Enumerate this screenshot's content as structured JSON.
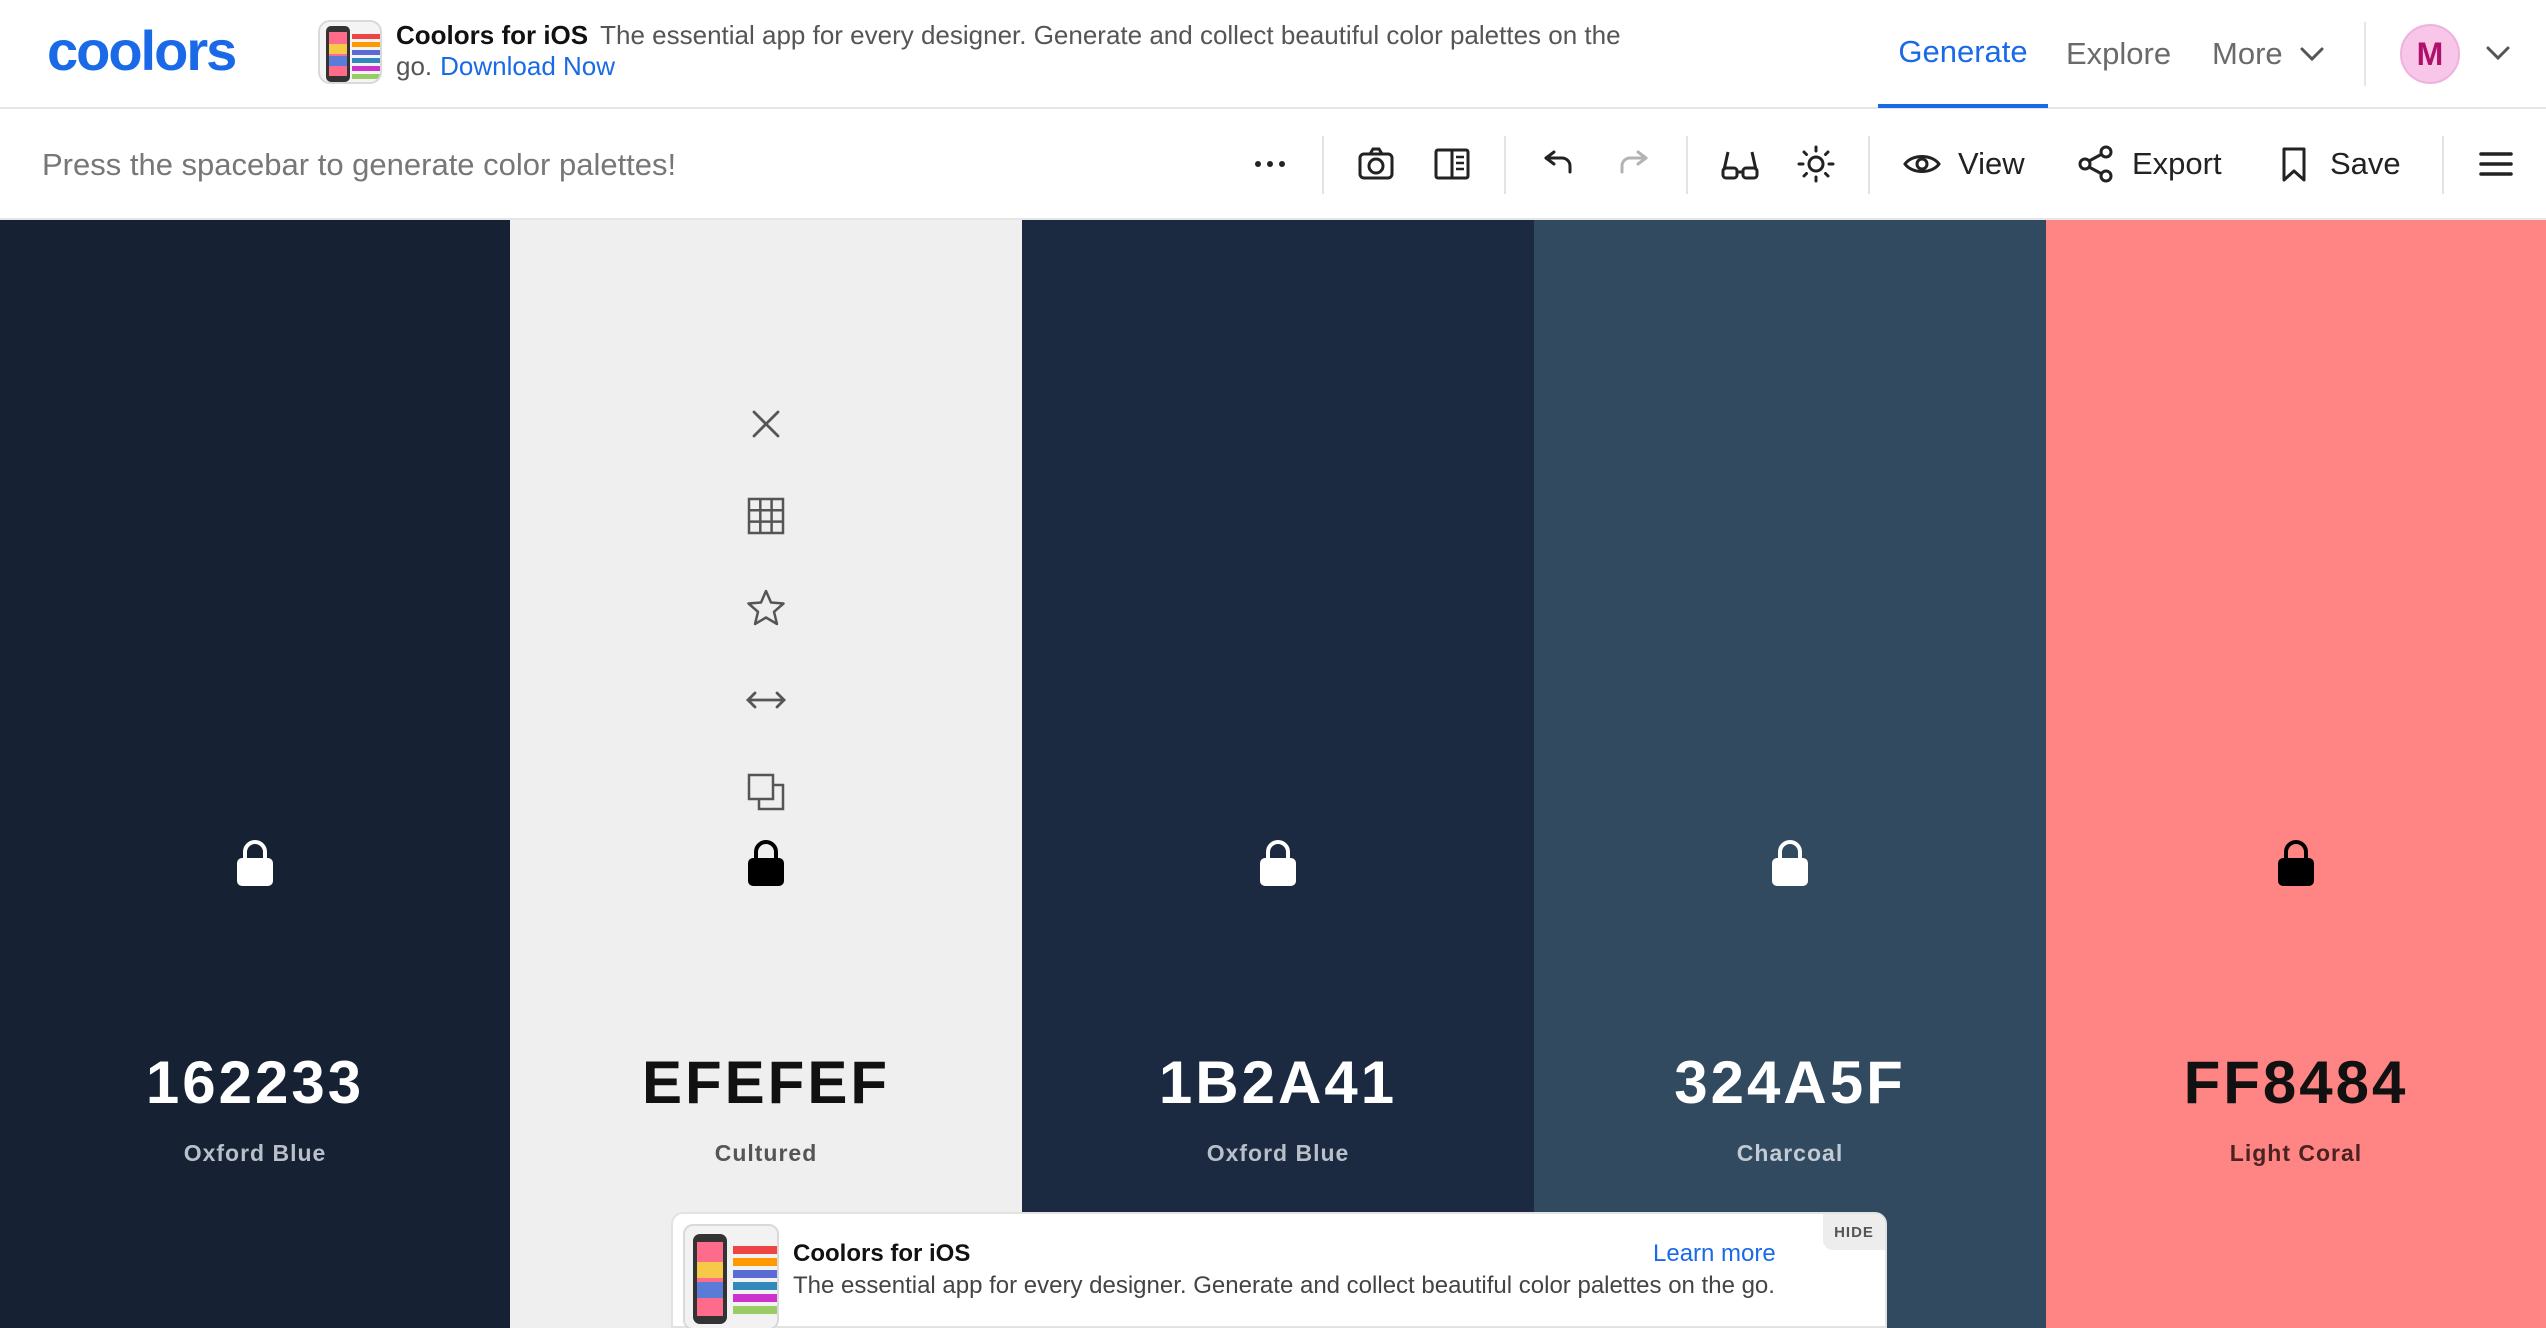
{
  "brand": {
    "logo_text": "coolors"
  },
  "promo": {
    "title": "Coolors for iOS",
    "text": "The essential app for every designer. Generate and collect beautiful color palettes on the go.",
    "link": "Download Now"
  },
  "nav": {
    "generate": "Generate",
    "explore": "Explore",
    "more": "More",
    "avatar_initial": "M",
    "active_color": "#1a6ae8"
  },
  "toolbar": {
    "hint": "Press the spacebar to generate color palettes!",
    "view_label": "View",
    "export_label": "Export",
    "save_label": "Save",
    "icons": [
      "more-options-icon",
      "camera-icon",
      "side-panel-icon",
      "undo-icon",
      "redo-icon",
      "glasses-icon",
      "sun-icon",
      "eye-icon",
      "share-icon",
      "bookmark-icon",
      "hamburger-menu-icon"
    ]
  },
  "palette": [
    {
      "hex": "162233",
      "name": "Oxford Blue",
      "bg": "#162233",
      "fg": "#ffffff",
      "sub": "#b8bfc9"
    },
    {
      "hex": "EFEFEF",
      "name": "Cultured",
      "bg": "#EFEFEF",
      "fg": "#111111",
      "sub": "#555555"
    },
    {
      "hex": "1B2A41",
      "name": "Oxford Blue",
      "bg": "#1B2A41",
      "fg": "#ffffff",
      "sub": "#b8bfc9"
    },
    {
      "hex": "324A5F",
      "name": "Charcoal",
      "bg": "#324A5F",
      "fg": "#ffffff",
      "sub": "#c2cad3"
    },
    {
      "hex": "FF8484",
      "name": "Light Coral",
      "bg": "#FF8484",
      "fg": "#111111",
      "sub": "#4a2222"
    }
  ],
  "swatch_tools": [
    "close-icon",
    "shades-grid-icon",
    "favorite-star-icon",
    "drag-arrows-icon",
    "copy-icon"
  ],
  "ad": {
    "title": "Coolors for iOS",
    "text": "The essential app for every designer. Generate and collect beautiful color palettes on the go.",
    "learn_more": "Learn more",
    "hide": "HIDE"
  }
}
